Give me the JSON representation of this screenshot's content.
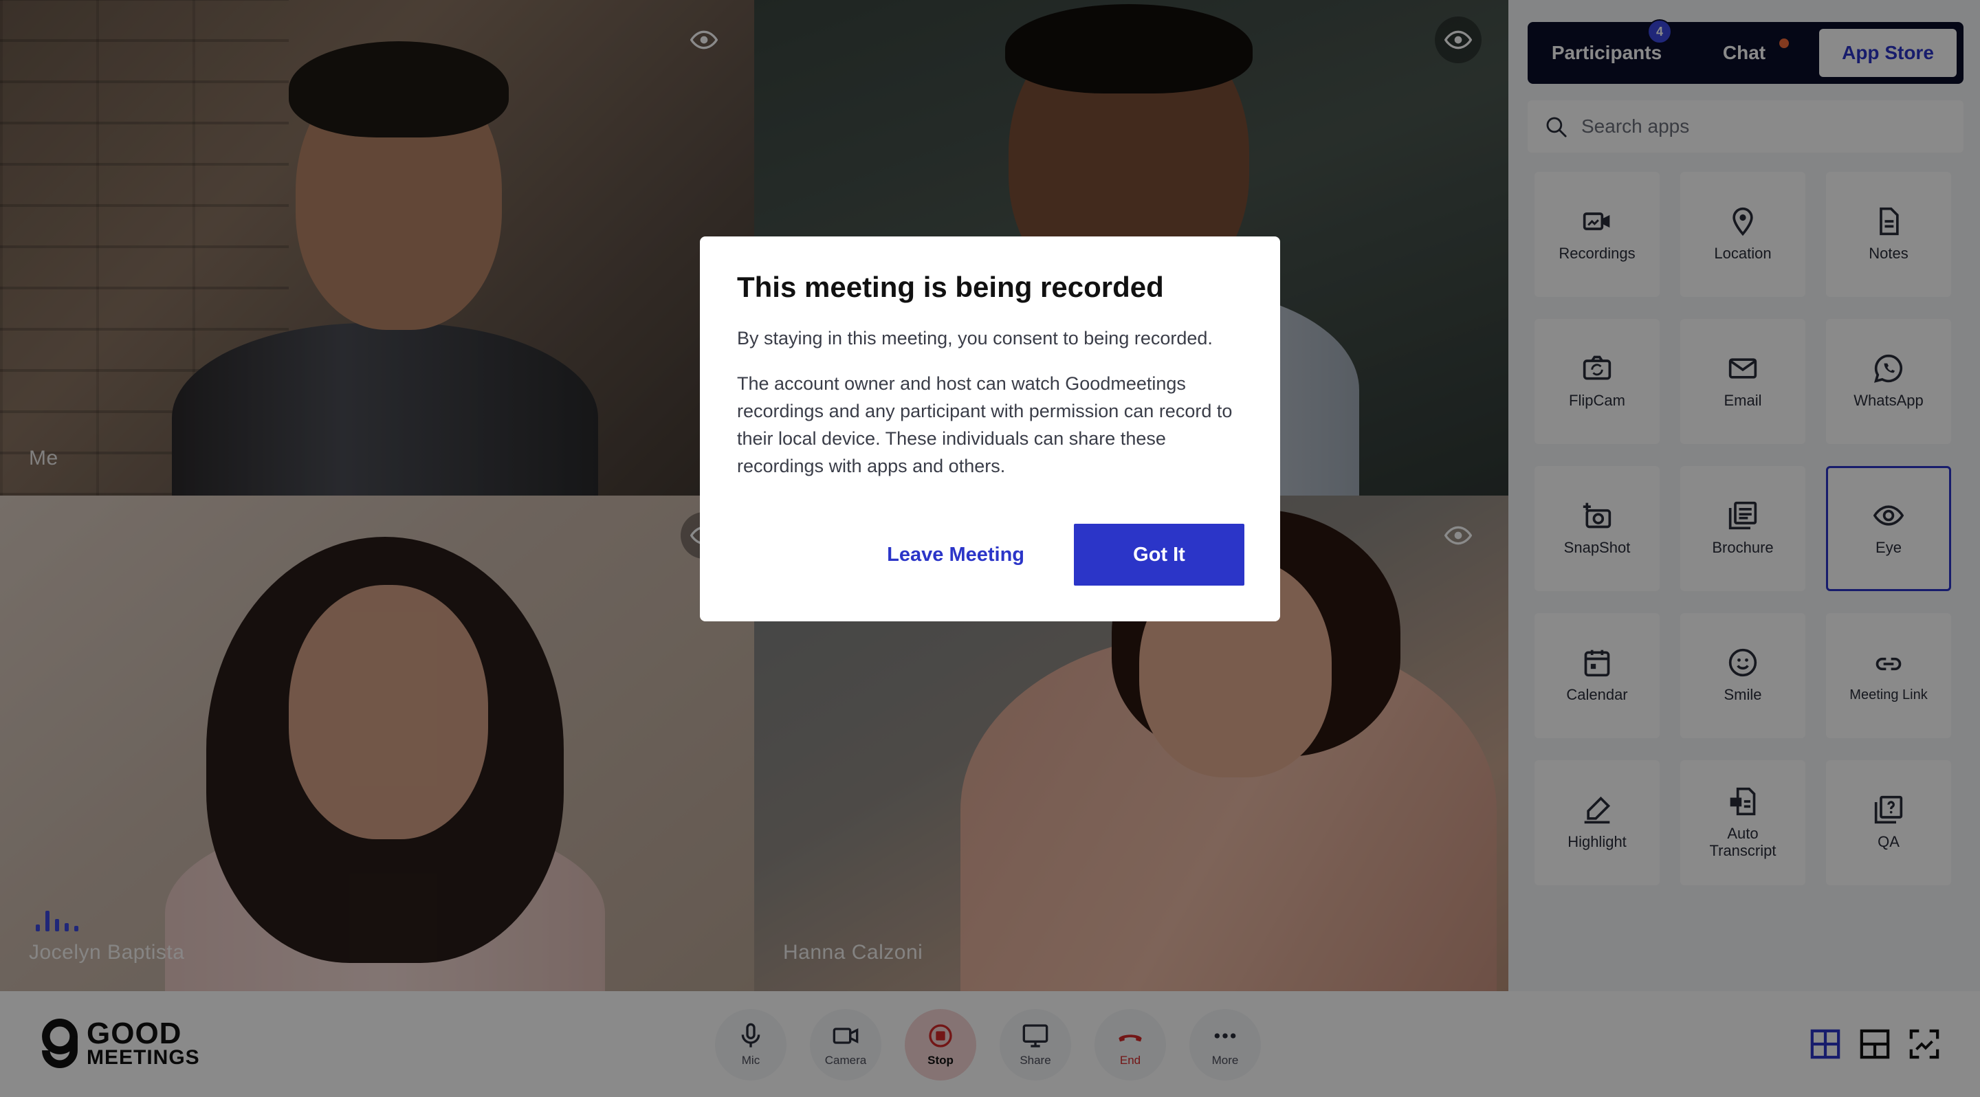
{
  "participants": {
    "tile1": {
      "name": "Me"
    },
    "tile2": {
      "name": ""
    },
    "tile3": {
      "name": "Jocelyn Baptista"
    },
    "tile4": {
      "name": "Hanna Calzoni"
    }
  },
  "panel": {
    "tabs": [
      {
        "label": "Participants",
        "badge": "4"
      },
      {
        "label": "Chat"
      },
      {
        "label": "App Store"
      }
    ],
    "search": {
      "placeholder": "Search apps"
    },
    "apps": [
      {
        "label": "Recordings",
        "icon": "video-icon"
      },
      {
        "label": "Location",
        "icon": "location-pin-icon"
      },
      {
        "label": "Notes",
        "icon": "document-icon"
      },
      {
        "label": "FlipCam",
        "icon": "flip-camera-icon"
      },
      {
        "label": "Email",
        "icon": "envelope-icon"
      },
      {
        "label": "WhatsApp",
        "icon": "whatsapp-icon"
      },
      {
        "label": "SnapShot",
        "icon": "snapshot-icon"
      },
      {
        "label": "Brochure",
        "icon": "brochure-icon"
      },
      {
        "label": "Eye",
        "icon": "eye-icon"
      },
      {
        "label": "Calendar",
        "icon": "calendar-icon"
      },
      {
        "label": "Smile",
        "icon": "smile-icon"
      },
      {
        "label": "Meeting Link",
        "icon": "link-icon"
      },
      {
        "label": "Highlight",
        "icon": "highlighter-icon"
      },
      {
        "label": "Auto\nTranscript",
        "icon": "transcript-icon"
      },
      {
        "label": "QA",
        "icon": "question-icon"
      }
    ]
  },
  "toolbar": {
    "logo": {
      "line1": "GOOD",
      "line2": "MEETINGS"
    },
    "controls": [
      {
        "label": "Mic"
      },
      {
        "label": "Camera"
      },
      {
        "label": "Stop"
      },
      {
        "label": "Share"
      },
      {
        "label": "End"
      },
      {
        "label": "More"
      }
    ]
  },
  "modal": {
    "title": "This meeting is being recorded",
    "p1": "By staying in this meeting, you consent to being recorded.",
    "p2": "The account owner and host can watch Goodmeetings recordings and any participant with permission can record to their local device. These individuals can share these recordings with apps and others.",
    "leave_label": "Leave Meeting",
    "ok_label": "Got It"
  },
  "colors": {
    "accent": "#2b35c8",
    "tabs_bg": "#0b0d2a",
    "stop_bg": "#f6d5d5",
    "end": "#d42a2a"
  }
}
